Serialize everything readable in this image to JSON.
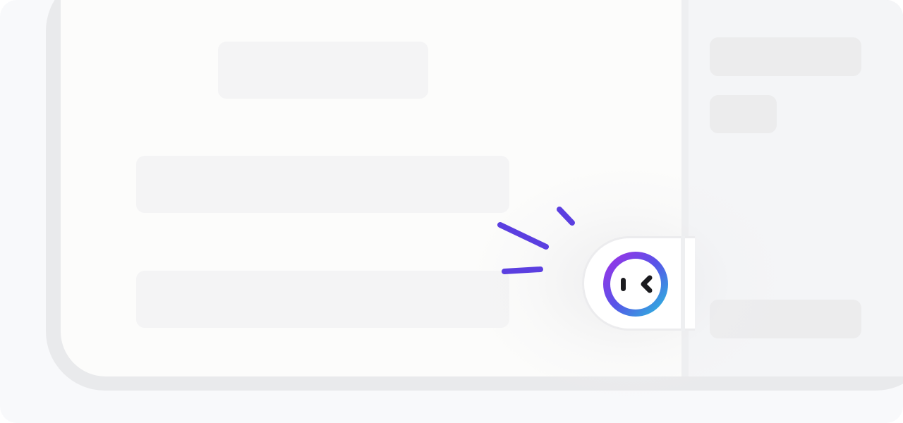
{
  "theme": {
    "accent": "#5b3fe0",
    "accent_gradient": [
      "#8a36e8",
      "#4e5ce6",
      "#2fb4e0"
    ],
    "panel_bg": "#fcfcfb",
    "sidebar_bg": "#f4f5f7"
  },
  "assistant": {
    "icon": "smiling-face-icon",
    "state": "winking"
  }
}
